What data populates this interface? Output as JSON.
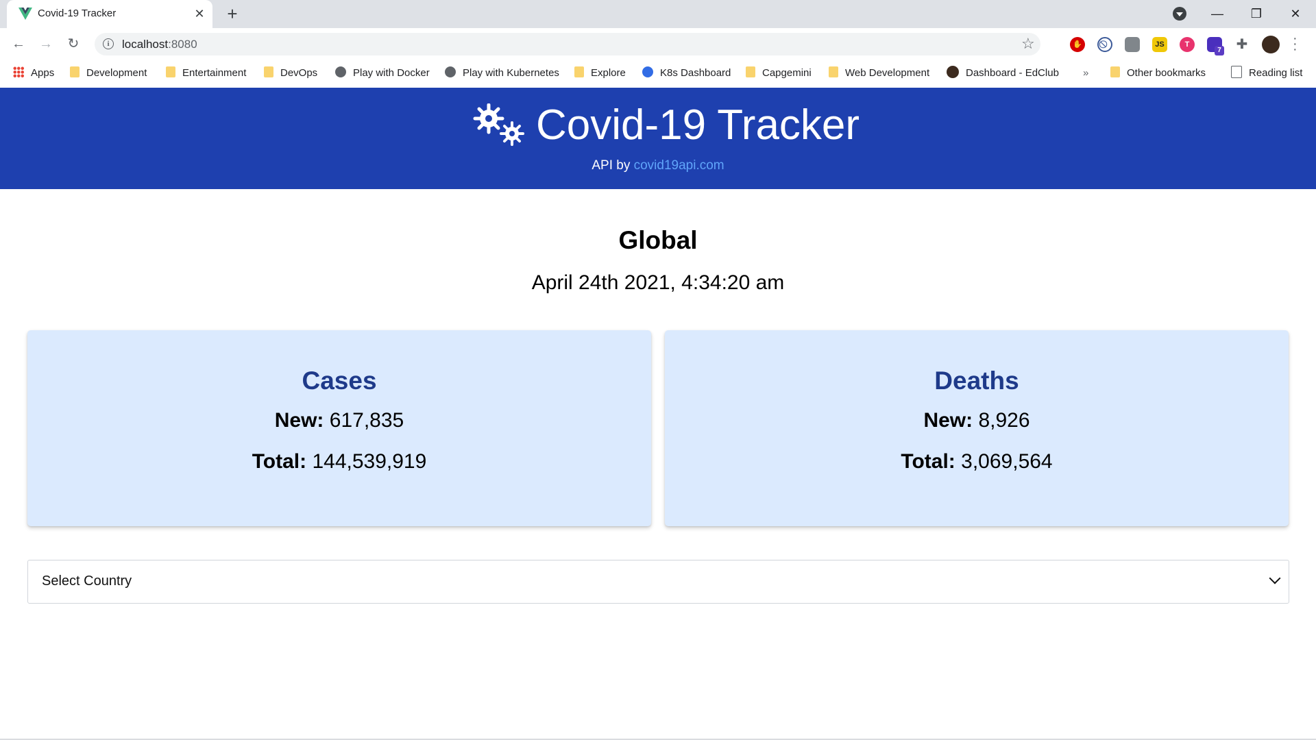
{
  "browser": {
    "tab_title": "Covid-19 Tracker",
    "url_host": "localhost",
    "url_port": ":8080",
    "bookmarks": [
      {
        "label": "Apps",
        "icon": "apps-grid-icon"
      },
      {
        "label": "Development",
        "icon": "folder-icon"
      },
      {
        "label": "Entertainment",
        "icon": "folder-icon"
      },
      {
        "label": "DevOps",
        "icon": "folder-icon"
      },
      {
        "label": "Play with Docker",
        "icon": "globe-icon"
      },
      {
        "label": "Play with Kubernetes",
        "icon": "globe-icon"
      },
      {
        "label": "Explore",
        "icon": "folder-icon"
      },
      {
        "label": "K8s Dashboard",
        "icon": "kubernetes-icon"
      },
      {
        "label": "Capgemini",
        "icon": "folder-icon"
      },
      {
        "label": "Web Development",
        "icon": "folder-icon"
      },
      {
        "label": "Dashboard - EdClub",
        "icon": "edclub-icon"
      }
    ],
    "bookmarks_overflow": "»",
    "other_bookmarks": "Other bookmarks",
    "reading_list": "Reading list",
    "extensions": [
      {
        "icon": "adblock-icon",
        "color": "#d50000"
      },
      {
        "icon": "block-icon",
        "color": "#5f6368"
      },
      {
        "icon": "extension-gray-icon",
        "color": "#80868b"
      },
      {
        "icon": "js-icon",
        "color": "#f0c808"
      },
      {
        "icon": "t-icon",
        "color": "#e8336d"
      },
      {
        "icon": "graduation-icon",
        "color": "#4a2fbd",
        "badge": "7"
      }
    ]
  },
  "header": {
    "title": "Covid-19 Tracker",
    "subtitle_prefix": "API by ",
    "subtitle_link": "covid19api.com"
  },
  "global": {
    "title": "Global",
    "date": "April 24th 2021, 4:34:20 am"
  },
  "cards": [
    {
      "title": "Cases",
      "new_label": "New:",
      "new_value": "617,835",
      "total_label": "Total:",
      "total_value": "144,539,919"
    },
    {
      "title": "Deaths",
      "new_label": "New:",
      "new_value": "8,926",
      "total_label": "Total:",
      "total_value": "3,069,564"
    }
  ],
  "country_select": {
    "selected": "Select Country"
  },
  "colors": {
    "header_bg": "#1e40af",
    "link": "#60a5fa",
    "card_bg": "#dbeafe",
    "card_title": "#1e3a8a"
  }
}
